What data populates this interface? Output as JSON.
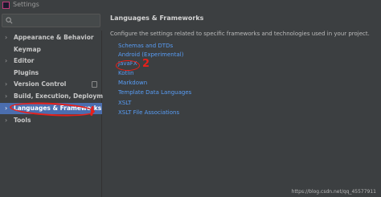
{
  "window": {
    "title": "Settings"
  },
  "search": {
    "placeholder": ""
  },
  "sidebar": {
    "items": [
      {
        "label": "Appearance & Behavior",
        "expandable": true,
        "selected": false
      },
      {
        "label": "Keymap",
        "expandable": false,
        "selected": false
      },
      {
        "label": "Editor",
        "expandable": true,
        "selected": false
      },
      {
        "label": "Plugins",
        "expandable": false,
        "selected": false
      },
      {
        "label": "Version Control",
        "expandable": true,
        "selected": false
      },
      {
        "label": "Build, Execution, Deployment",
        "expandable": true,
        "selected": false
      },
      {
        "label": "Languages & Frameworks",
        "expandable": true,
        "selected": true
      },
      {
        "label": "Tools",
        "expandable": true,
        "selected": false
      }
    ]
  },
  "main": {
    "title": "Languages & Frameworks",
    "description": "Configure the settings related to specific frameworks and technologies used in your project.",
    "links": [
      "Schemas and DTDs",
      "Android (Experimental)",
      "JavaFX",
      "Kotlin",
      "Markdown",
      "Template Data Languages",
      "XSLT",
      "XSLT File Associations"
    ]
  },
  "annotations": {
    "step_one": "1",
    "step_two": "2"
  },
  "watermark": "https://blog.csdn.net/qq_45577911",
  "colors": {
    "selection": "#4b6eaf",
    "link": "#589df6",
    "annotation": "#e8201a",
    "background": "#3c3f41"
  }
}
